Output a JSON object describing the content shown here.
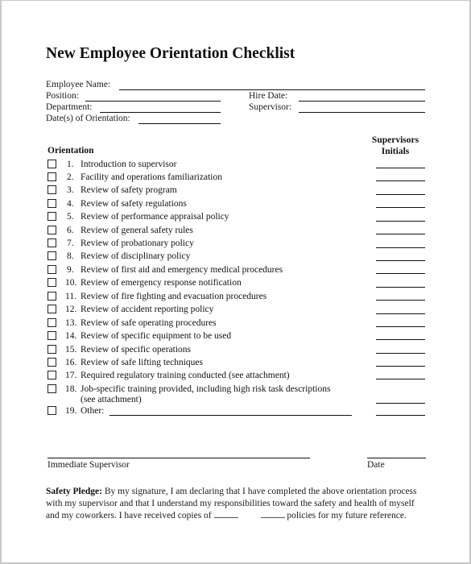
{
  "document": {
    "title": "New Employee Orientation Checklist",
    "fields": {
      "employee_name": "Employee Name:",
      "position": "Position:",
      "hire_date": "Hire Date:",
      "department": "Department:",
      "supervisor": "Supervisor:",
      "dates_of_orientation": "Date(s) of Orientation:"
    },
    "section_heading": "Orientation",
    "initials_heading_line1": "Supervisors",
    "initials_heading_line2": "Initials",
    "items": [
      {
        "num": "1.",
        "text": "Introduction to supervisor"
      },
      {
        "num": "2.",
        "text": "Facility and operations familiarization"
      },
      {
        "num": "3.",
        "text": "Review of safety program"
      },
      {
        "num": "4.",
        "text": "Review of safety regulations"
      },
      {
        "num": "5.",
        "text": "Review of performance appraisal policy"
      },
      {
        "num": "6.",
        "text": "Review of general safety rules"
      },
      {
        "num": "7.",
        "text": "Review of probationary policy"
      },
      {
        "num": "8.",
        "text": "Review of disciplinary policy"
      },
      {
        "num": "9.",
        "text": "Review of first aid and emergency medical procedures"
      },
      {
        "num": "10.",
        "text": "Review of emergency response notification"
      },
      {
        "num": "11.",
        "text": "Review of fire fighting and evacuation procedures"
      },
      {
        "num": "12.",
        "text": "Review of accident reporting policy"
      },
      {
        "num": "13.",
        "text": "Review of safe operating procedures"
      },
      {
        "num": "14.",
        "text": "Review of specific equipment to be used"
      },
      {
        "num": "15.",
        "text": "Review of specific operations"
      },
      {
        "num": "16.",
        "text": "Review of safe lifting techniques"
      },
      {
        "num": "17.",
        "text": "Required regulatory training conducted (see attachment)"
      },
      {
        "num": "18.",
        "text": "Job-specific training provided, including high risk task descriptions",
        "text2": "(see attachment)"
      },
      {
        "num": "19.",
        "text": "Other:"
      }
    ],
    "signature": {
      "supervisor_label": "Immediate Supervisor",
      "date_label": "Date"
    },
    "pledge": {
      "heading": "Safety Pledge:",
      "line1": " By my signature, I am declaring that I have completed the above orientation process",
      "line2": "with my supervisor and that I understand my responsibilities toward the safety and health of myself",
      "line3a": "and my coworkers. I have received copies of ",
      "line3b": " policies for my future reference."
    }
  }
}
